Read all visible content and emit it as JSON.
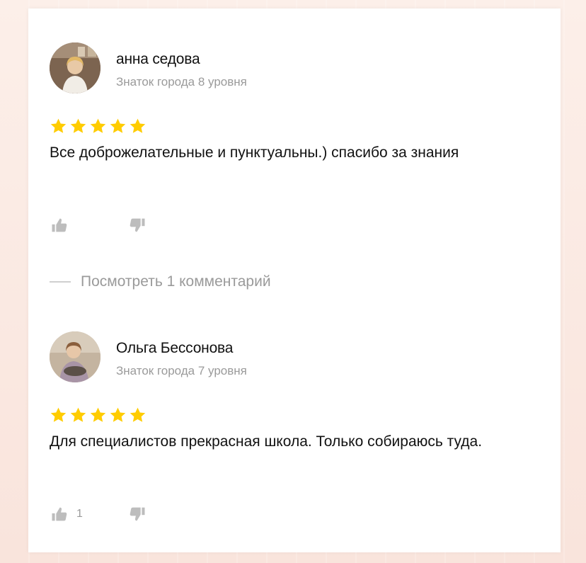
{
  "reviews": [
    {
      "author": "анна седова",
      "level": "Знаток города 8 уровня",
      "rating": 5,
      "text": "Все доброжелательные и пунктуальны.) спасибо за знания",
      "likes": "",
      "dislikes": ""
    },
    {
      "author": "Ольга Бессонова",
      "level": "Знаток города 7 уровня",
      "rating": 5,
      "text": "Для специалистов прекрасная школа. Только собираюсь туда.",
      "likes": "1",
      "dislikes": ""
    }
  ],
  "comments_link": "Посмотреть 1 комментарий",
  "colors": {
    "star": "#ffcc00",
    "muted": "#9a9a9a",
    "text": "#111111"
  },
  "icons": {
    "star": "star-icon",
    "like": "thumbs-up-icon",
    "dislike": "thumbs-down-icon"
  }
}
